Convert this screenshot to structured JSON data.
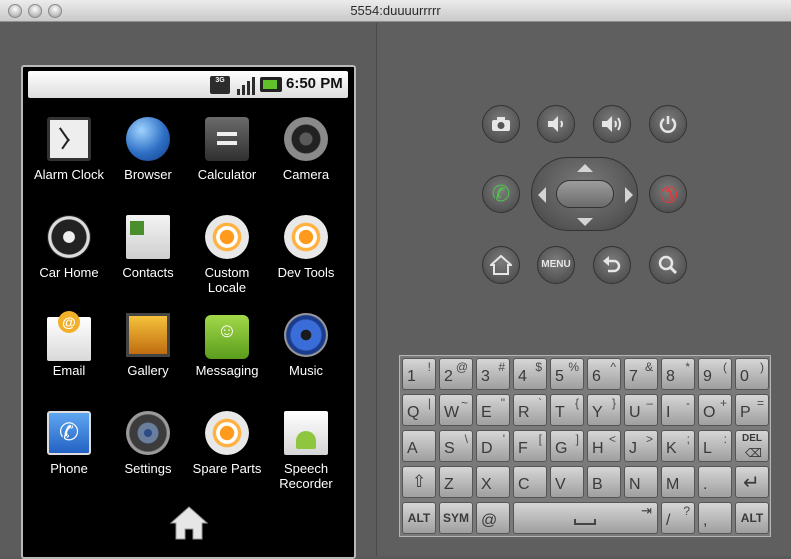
{
  "window": {
    "title": "5554:duuuurrrrr"
  },
  "status_bar": {
    "network": "3G",
    "time": "6:50 PM"
  },
  "apps": [
    {
      "label": "Alarm Clock",
      "icon": "alarm-clock-icon"
    },
    {
      "label": "Browser",
      "icon": "globe-icon"
    },
    {
      "label": "Calculator",
      "icon": "calculator-icon"
    },
    {
      "label": "Camera",
      "icon": "camera-icon"
    },
    {
      "label": "Car Home",
      "icon": "steering-wheel-icon"
    },
    {
      "label": "Contacts",
      "icon": "contacts-icon"
    },
    {
      "label": "Custom\nLocale",
      "icon": "gear-icon"
    },
    {
      "label": "Dev Tools",
      "icon": "gear-icon"
    },
    {
      "label": "Email",
      "icon": "email-icon"
    },
    {
      "label": "Gallery",
      "icon": "gallery-icon"
    },
    {
      "label": "Messaging",
      "icon": "messaging-icon"
    },
    {
      "label": "Music",
      "icon": "music-icon"
    },
    {
      "label": "Phone",
      "icon": "phone-icon"
    },
    {
      "label": "Settings",
      "icon": "settings-icon"
    },
    {
      "label": "Spare Parts",
      "icon": "gear-icon"
    },
    {
      "label": "Speech\nRecorder",
      "icon": "recorder-icon"
    }
  ],
  "controls": {
    "menu_label": "MENU"
  },
  "keyboard": {
    "row1": [
      [
        "1",
        "!"
      ],
      [
        "2",
        "@"
      ],
      [
        "3",
        "#"
      ],
      [
        "4",
        "$"
      ],
      [
        "5",
        "%"
      ],
      [
        "6",
        "^"
      ],
      [
        "7",
        "&"
      ],
      [
        "8",
        "*"
      ],
      [
        "9",
        "("
      ],
      [
        "0",
        ")"
      ]
    ],
    "row2": [
      [
        "Q",
        "|"
      ],
      [
        "W",
        "~"
      ],
      [
        "E",
        "\""
      ],
      [
        "R",
        "`"
      ],
      [
        "T",
        "{"
      ],
      [
        "Y",
        "}"
      ],
      [
        "U",
        "–"
      ],
      [
        "I",
        "-"
      ],
      [
        "O",
        "+"
      ],
      [
        "P",
        "="
      ]
    ],
    "row3": [
      [
        "A",
        ""
      ],
      [
        "S",
        "\\"
      ],
      [
        "D",
        "'"
      ],
      [
        "F",
        "["
      ],
      [
        "G",
        "]"
      ],
      [
        "H",
        "<"
      ],
      [
        "J",
        ">"
      ],
      [
        "K",
        ";"
      ],
      [
        "L",
        ":"
      ]
    ],
    "del_label": "DEL",
    "row4": [
      "Z",
      "X",
      "C",
      "V",
      "B",
      "N",
      "M",
      "."
    ],
    "alt_label": "ALT",
    "sym_label": "SYM",
    "at_label": "@",
    "slash_main": "/",
    "slash_shift": "?",
    "comma_label": ","
  }
}
